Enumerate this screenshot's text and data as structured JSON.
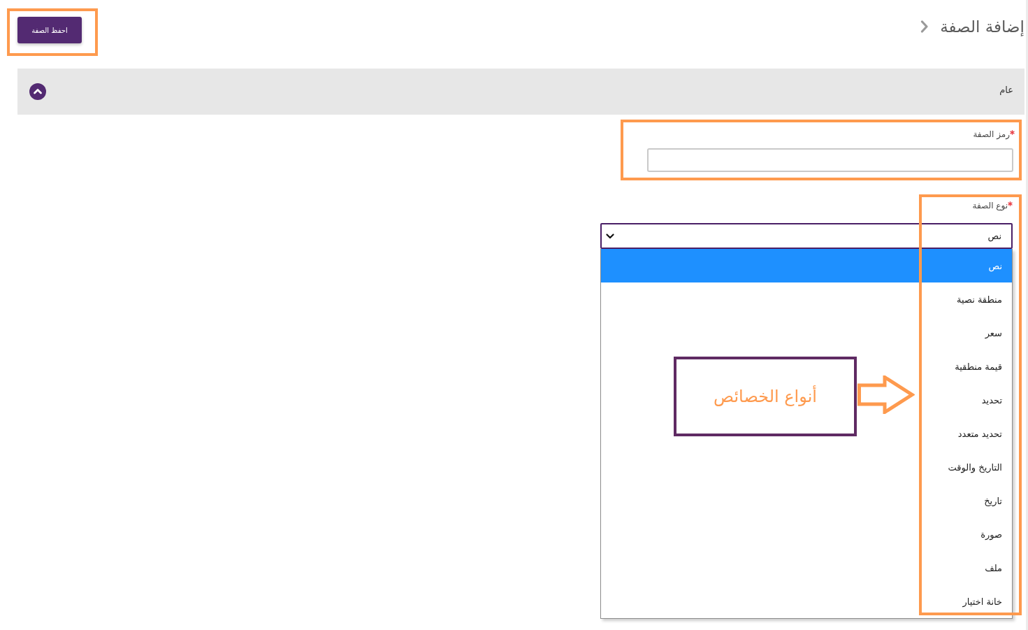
{
  "header": {
    "title": "إضافة الصفة",
    "save_button": {
      "label": "احفظ الصفة",
      "highlighted": true
    }
  },
  "section": {
    "title": "عام",
    "expanded": true,
    "fields": [
      {
        "kind": "text",
        "label": "رمز الصفة",
        "required": true,
        "highlighted": true
      },
      {
        "kind": "select",
        "label": "نوع الصفة",
        "required": true,
        "value": "نص",
        "open": true,
        "options_highlighted": true,
        "options": [
          {
            "label": "نص",
            "selected": true
          },
          {
            "label": "منطقة نصية",
            "selected": false
          },
          {
            "label": "سعر",
            "selected": false
          },
          {
            "label": "قيمة منطقية",
            "selected": false
          },
          {
            "label": "تحديد",
            "selected": false
          },
          {
            "label": "تحديد متعدد",
            "selected": false
          },
          {
            "label": "التاريخ والوقت",
            "selected": false
          },
          {
            "label": "تاريخ",
            "selected": false
          },
          {
            "label": "صورة",
            "selected": false
          },
          {
            "label": "ملف",
            "selected": false
          },
          {
            "label": "خانة اختيار",
            "selected": false
          }
        ]
      }
    ]
  },
  "callout": {
    "text": "أنواع الخصائص"
  }
}
